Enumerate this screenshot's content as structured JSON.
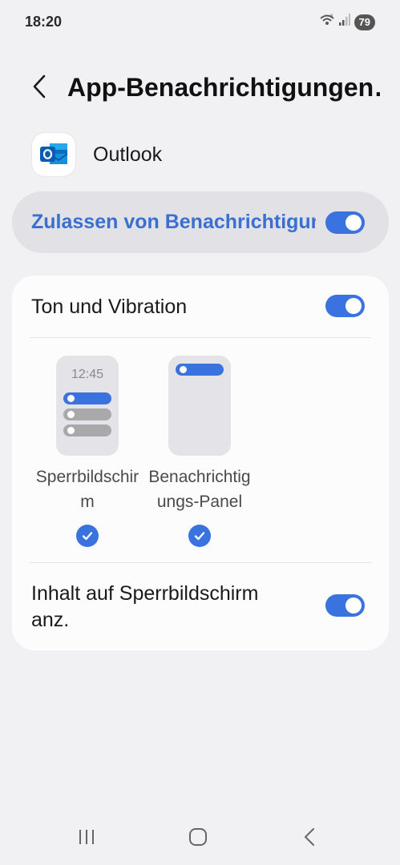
{
  "status_bar": {
    "time": "18:20",
    "battery": "79",
    "icons": [
      "wifi-icon",
      "signal-icon"
    ]
  },
  "header": {
    "back_icon": "chevron-left-icon",
    "title": "App-Benachrichtigungen"
  },
  "app": {
    "name": "Outlook",
    "icon": "outlook-icon"
  },
  "master_toggle": {
    "label": "Zulassen von Benachrichtigungen",
    "on": true
  },
  "settings": {
    "sound_vibration": {
      "label": "Ton und Vibration",
      "on": true
    },
    "styles": [
      {
        "preview_time": "12:45",
        "label": "Sperrbildschirm",
        "selected": true
      },
      {
        "label": "Benachrichtigungs-Panel",
        "selected": true
      }
    ],
    "lockscreen_content": {
      "label": "Inhalt auf Sperrbildschirm anz.",
      "on": true
    }
  },
  "nav_bar": {
    "items": [
      "recents-icon",
      "home-icon",
      "back-icon"
    ]
  },
  "colors": {
    "accent": "#3a72e0",
    "background": "#f1f1f3"
  }
}
